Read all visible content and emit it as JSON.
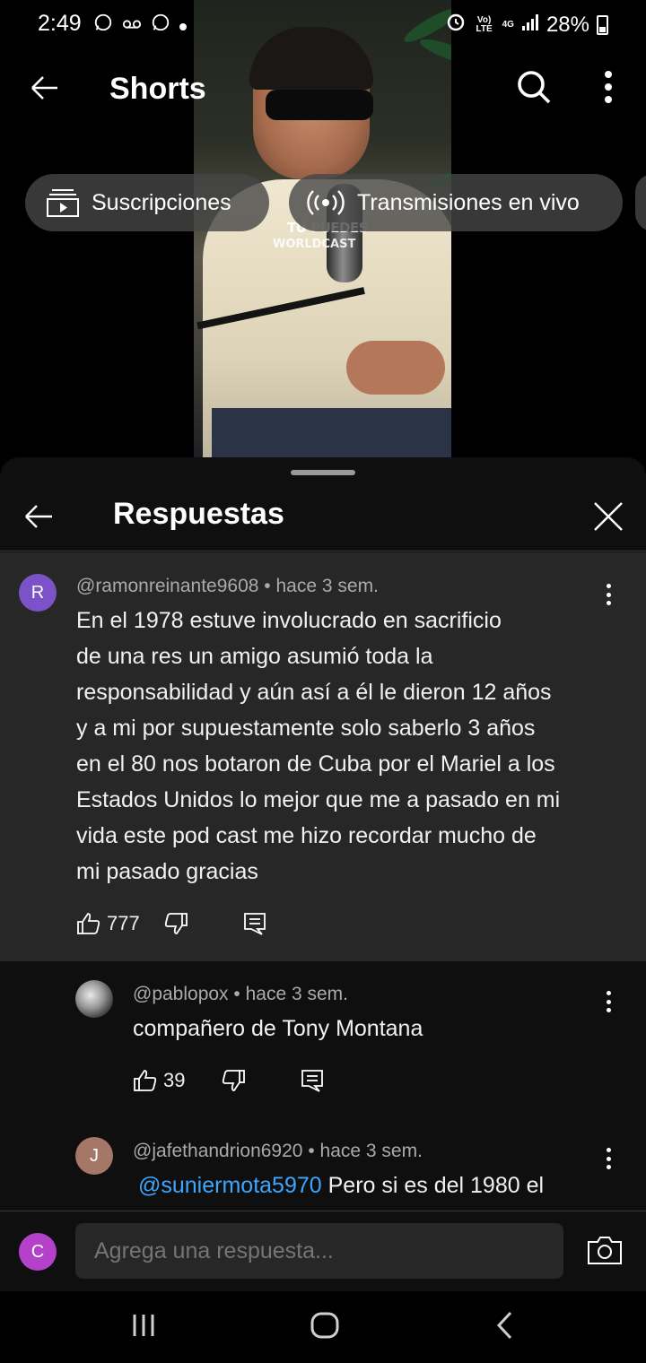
{
  "status_bar": {
    "time": "2:49",
    "battery": "28%",
    "network": "4G",
    "volte": "Vo) LTE"
  },
  "header": {
    "title": "Shorts"
  },
  "chips": [
    {
      "label": "Suscripciones",
      "icon": "subscriptions-icon"
    },
    {
      "label": "Transmisiones en vivo",
      "icon": "live-broadcast-icon"
    }
  ],
  "video": {
    "watermark_line1": "TÚ PUEDES",
    "watermark_line2": "WORLDCAST"
  },
  "replies_sheet": {
    "title": "Respuestas",
    "parent_comment": {
      "avatar_letter": "R",
      "avatar_color": "#7b52c8",
      "author": "@ramonreinante9608",
      "time": "hace 3 sem.",
      "lines": [
        "En el 1978 estuve involucrado en sacrificio",
        "de una res un amigo asumió toda la",
        "responsabilidad y aún así a él le dieron 12 años",
        "y a mi por supuestamente solo saberlo 3 años",
        "en el 80 nos botaron de Cuba por el Mariel a los",
        "Estados Unidos lo mejor que me a pasado en mi",
        "vida este pod cast me hizo recordar mucho de",
        "mi pasado gracias"
      ],
      "likes": "777"
    },
    "replies": [
      {
        "author": "@pablopox",
        "time": "hace 3 sem.",
        "text": "compañero de Tony Montana",
        "likes": "39"
      },
      {
        "avatar_letter": "J",
        "avatar_color": "#a47766",
        "author": "@jafethandrion6920",
        "time": "hace 3 sem.",
        "mention": "@suniermota5970",
        "text": " Pero si es del 1980 el"
      }
    ],
    "composer": {
      "avatar_letter": "C",
      "avatar_color": "#b341c9",
      "placeholder": "Agrega una respuesta..."
    }
  },
  "separator": "•"
}
